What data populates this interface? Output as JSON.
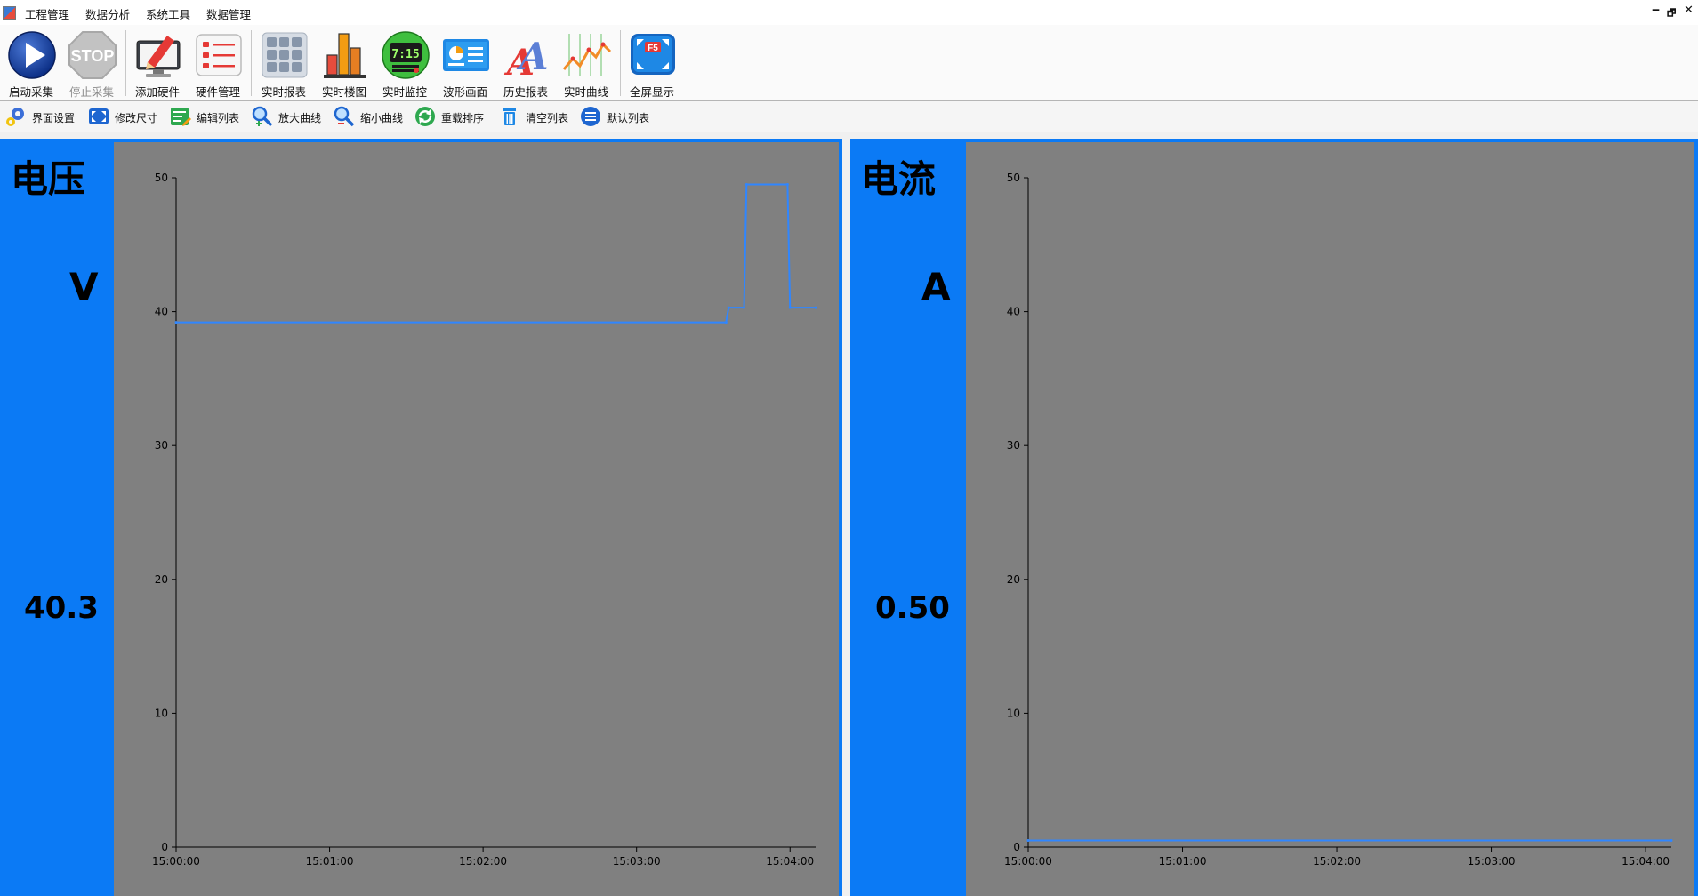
{
  "menu": {
    "items": [
      "工程管理",
      "数据分析",
      "系统工具",
      "数据管理"
    ],
    "window_controls": [
      "‒",
      "🗗",
      "✕"
    ]
  },
  "toolbar": {
    "buttons": [
      {
        "label": "启动采集",
        "icon": "play-icon",
        "enabled": true
      },
      {
        "label": "停止采集",
        "icon": "stop-icon",
        "enabled": false
      },
      {
        "label": "添加硬件",
        "icon": "monitor-pen-icon",
        "enabled": true
      },
      {
        "label": "硬件管理",
        "icon": "list-icon",
        "enabled": true
      },
      {
        "label": "实时报表",
        "icon": "grid-icon",
        "enabled": true
      },
      {
        "label": "实时楼图",
        "icon": "bar-chart-icon",
        "enabled": true
      },
      {
        "label": "实时监控",
        "icon": "clock-display-icon",
        "enabled": true
      },
      {
        "label": "波形画面",
        "icon": "dashboard-icon",
        "enabled": true
      },
      {
        "label": "历史报表",
        "icon": "font-icon",
        "enabled": true
      },
      {
        "label": "实时曲线",
        "icon": "line-chart-icon",
        "enabled": true
      },
      {
        "label": "全屏显示",
        "icon": "fullscreen-f5-icon",
        "enabled": true
      }
    ],
    "clock_text": "7:15",
    "fullscreen_key": "F5"
  },
  "toolbar2": {
    "buttons": [
      {
        "label": "界面设置",
        "icon": "gears-icon"
      },
      {
        "label": "修改尺寸",
        "icon": "resize-icon"
      },
      {
        "label": "编辑列表",
        "icon": "edit-list-icon"
      },
      {
        "label": "放大曲线",
        "icon": "zoom-in-icon"
      },
      {
        "label": "缩小曲线",
        "icon": "zoom-out-icon"
      },
      {
        "label": "重载排序",
        "icon": "reload-icon"
      },
      {
        "label": "清空列表",
        "icon": "trash-icon"
      },
      {
        "label": "默认列表",
        "icon": "default-list-icon"
      }
    ]
  },
  "panels": [
    {
      "title": "电压",
      "unit": "V",
      "value": "40.3"
    },
    {
      "title": "电流",
      "unit": "A",
      "value": "0.50"
    }
  ],
  "colors": {
    "panel_blue": "#0b7af5",
    "plot_bg": "#808080",
    "series_line": "#2f86ff"
  },
  "chart_data": [
    {
      "type": "line",
      "title": "",
      "xlabel": "",
      "ylabel": "",
      "ylim": [
        0,
        50
      ],
      "yticks": [
        0,
        10,
        20,
        30,
        40,
        50
      ],
      "xlim": [
        "15:00:00",
        "15:04:10"
      ],
      "xticks": [
        "15:00:00",
        "15:01:00",
        "15:02:00",
        "15:03:00",
        "15:04:00"
      ],
      "series": [
        {
          "x": [
            "15:00:00",
            "15:03:35",
            "15:03:36",
            "15:03:42",
            "15:03:43",
            "15:03:59",
            "15:04:00",
            "15:04:10"
          ],
          "y": [
            39.2,
            39.2,
            40.3,
            40.3,
            49.5,
            49.5,
            40.3,
            40.3
          ]
        }
      ]
    },
    {
      "type": "line",
      "title": "",
      "xlabel": "",
      "ylabel": "",
      "ylim": [
        0,
        50
      ],
      "yticks": [
        0,
        10,
        20,
        30,
        40,
        50
      ],
      "xlim": [
        "15:00:00",
        "15:04:10"
      ],
      "xticks": [
        "15:00:00",
        "15:01:00",
        "15:02:00",
        "15:03:00",
        "15:04:00"
      ],
      "series": [
        {
          "x": [
            "15:00:00",
            "15:04:10"
          ],
          "y": [
            0.5,
            0.5
          ]
        }
      ]
    }
  ]
}
